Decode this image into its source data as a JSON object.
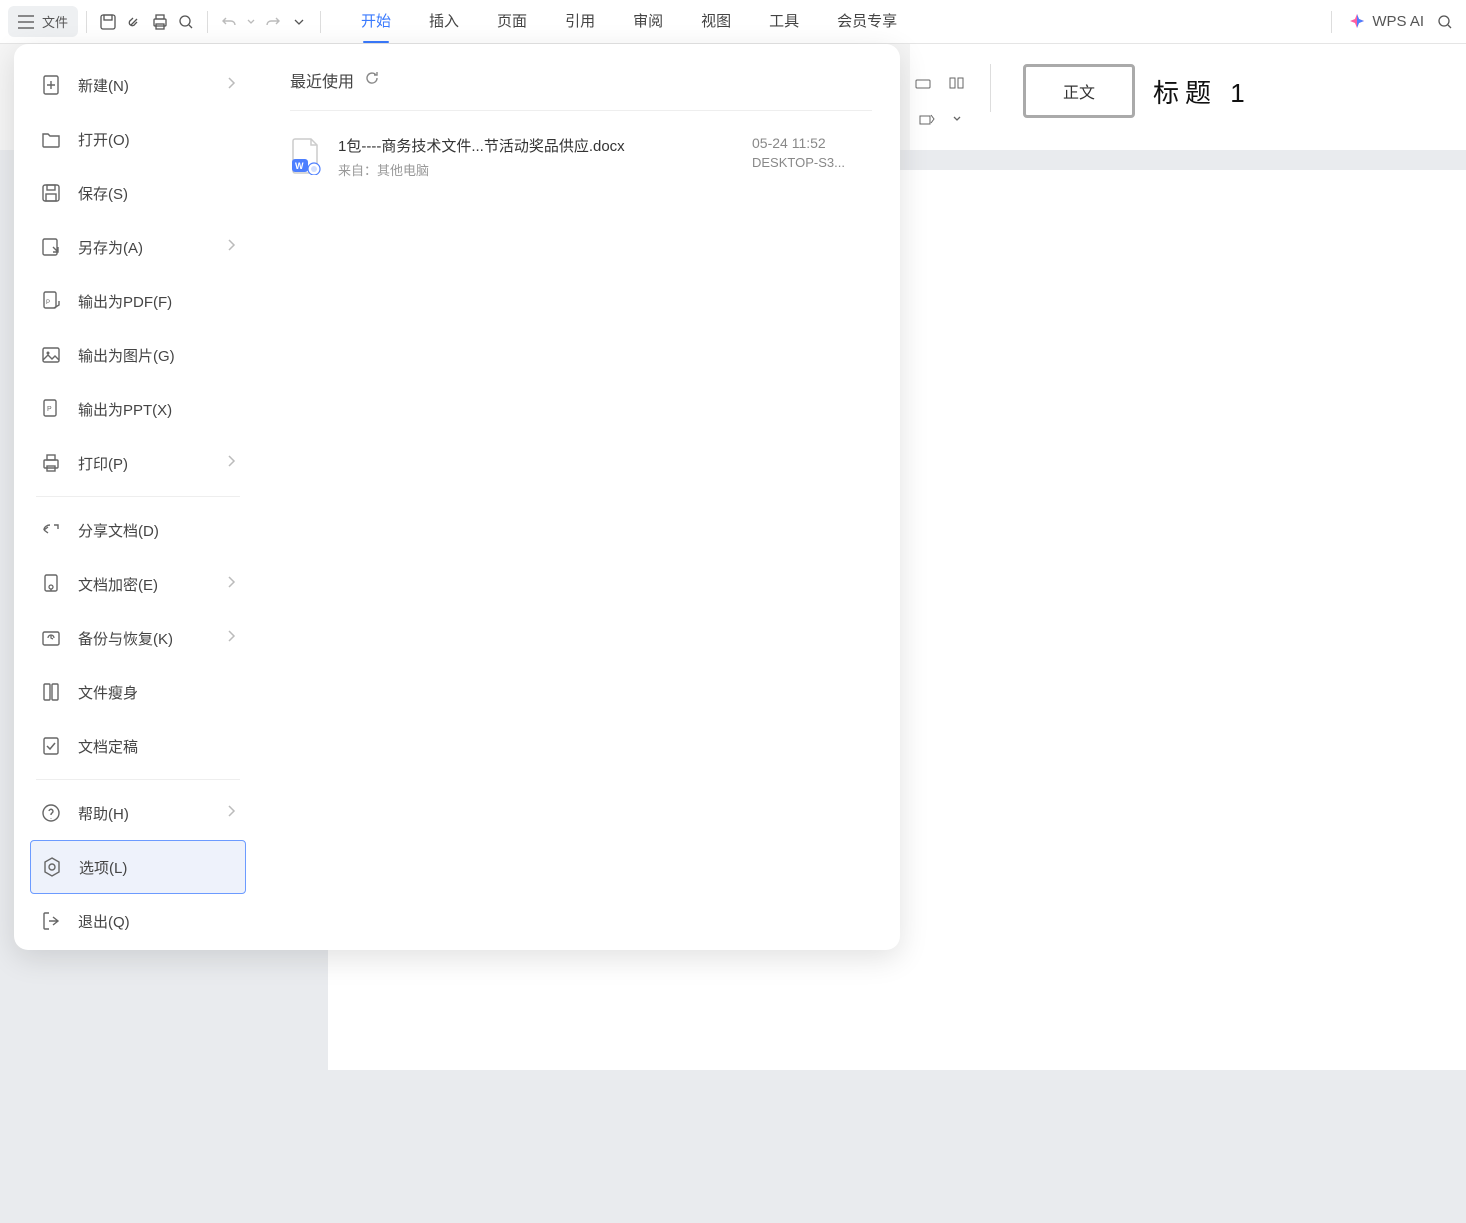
{
  "toolbar": {
    "file_label": "文件"
  },
  "tabs": {
    "start": "开始",
    "insert": "插入",
    "page": "页面",
    "reference": "引用",
    "review": "审阅",
    "view": "视图",
    "tools": "工具",
    "member": "会员专享"
  },
  "right": {
    "wps_ai": "WPS AI"
  },
  "styles": {
    "body": "正文",
    "heading1": "标题  1"
  },
  "file_menu": {
    "new": "新建(N)",
    "open": "打开(O)",
    "save": "保存(S)",
    "save_as": "另存为(A)",
    "export_pdf": "输出为PDF(F)",
    "export_image": "输出为图片(G)",
    "export_ppt": "输出为PPT(X)",
    "print": "打印(P)",
    "share": "分享文档(D)",
    "encrypt": "文档加密(E)",
    "backup": "备份与恢复(K)",
    "slim": "文件瘦身",
    "finalize": "文档定稿",
    "help": "帮助(H)",
    "options": "选项(L)",
    "exit": "退出(Q)"
  },
  "recent": {
    "header": "最近使用",
    "items": [
      {
        "name": "1包----商务技术文件...节活动奖品供应.docx",
        "source": "来自：其他电脑",
        "time": "05-24 11:52",
        "host": "DESKTOP-S3..."
      }
    ]
  }
}
